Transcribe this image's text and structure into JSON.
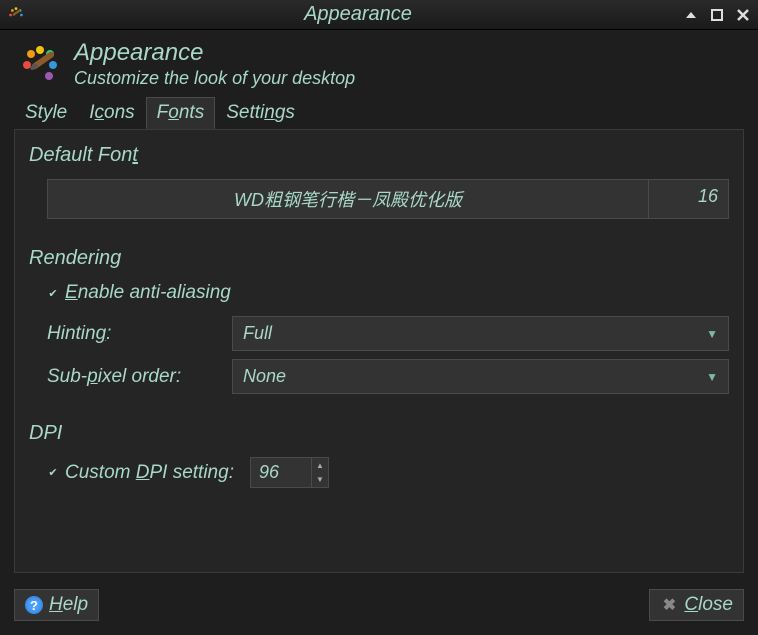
{
  "window": {
    "title": "Appearance"
  },
  "header": {
    "title": "Appearance",
    "subtitle": "Customize the look of your desktop"
  },
  "tabs": {
    "style": "Style",
    "icons_pre": "I",
    "icons_ul": "c",
    "icons_post": "ons",
    "fonts_pre": "F",
    "fonts_ul": "o",
    "fonts_post": "nts",
    "settings_pre": "Setti",
    "settings_ul": "n",
    "settings_post": "gs"
  },
  "fonts": {
    "default_font_label_pre": "Default Fon",
    "default_font_label_ul": "t",
    "font_name": "WD粗钢笔行楷－凤殿优化版",
    "font_size": "16",
    "rendering_label": "Rendering",
    "enable_aa_pre": "E",
    "enable_aa_ul": "n",
    "enable_aa_post": "able anti-aliasing",
    "hinting_label_pre": "Hintin",
    "hinting_label_ul": "g",
    "hinting_label_post": ":",
    "hinting_value": "Full",
    "subpixel_label_pre": "Sub-",
    "subpixel_label_ul": "p",
    "subpixel_label_post": "ixel order:",
    "subpixel_value": "None",
    "dpi_label": "DPI",
    "custom_dpi_pre": "Custom ",
    "custom_dpi_ul": "D",
    "custom_dpi_post": "PI setting:",
    "custom_dpi_value": "96"
  },
  "footer": {
    "help_ul": "H",
    "help_post": "elp",
    "close_ul": "C",
    "close_post": "lose"
  }
}
